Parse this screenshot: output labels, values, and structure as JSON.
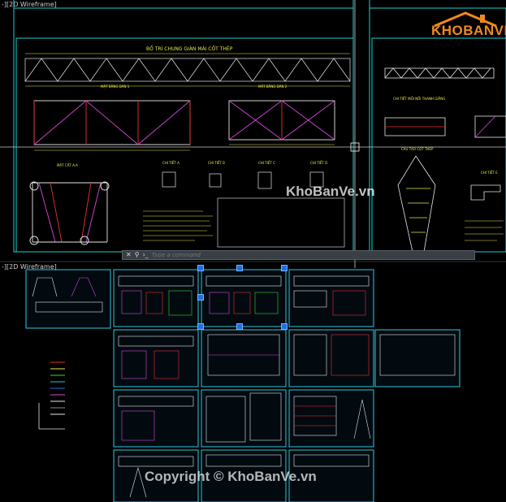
{
  "viewports": {
    "top_label": "-][2D Wireframe]",
    "bottom_label": "-][2D Wireframe]"
  },
  "drawing": {
    "main_title": "BỐ TRÍ CHUNG GIÀN MÁI CỐT THÉP",
    "section_1": "MẶT BẰNG DÀN 1",
    "section_2": "MẶT BẰNG DÀN 2",
    "section_3": "MẶT CẮT A-A",
    "detail_a": "CHI TIẾT A",
    "detail_b": "CHI TIẾT B",
    "detail_c": "CHI TIẾT C",
    "detail_d": "CHI TIẾT D",
    "right_title_1": "CHI TIẾT MỐI NỐI THANH GIẰNG",
    "right_title_2": "CẤU TẠO CỘT THÉP",
    "right_detail": "CHI TIẾT E"
  },
  "command": {
    "placeholder": "Type a command"
  },
  "watermarks": {
    "center": "KhoBanVe.vn",
    "bottom": "Copyright © KhoBanVe.vn",
    "logo": "KHOBANVE"
  },
  "colors": {
    "frame": "#19d3d3",
    "layout": "#2fc8e0",
    "line_white": "#e6e6e6",
    "yellow": "#e8e84a",
    "magenta": "#d846d8",
    "red": "#e83030",
    "green": "#3ad43a",
    "grip_blue": "#1e6fe0",
    "logo_orange": "#f08a1e"
  }
}
